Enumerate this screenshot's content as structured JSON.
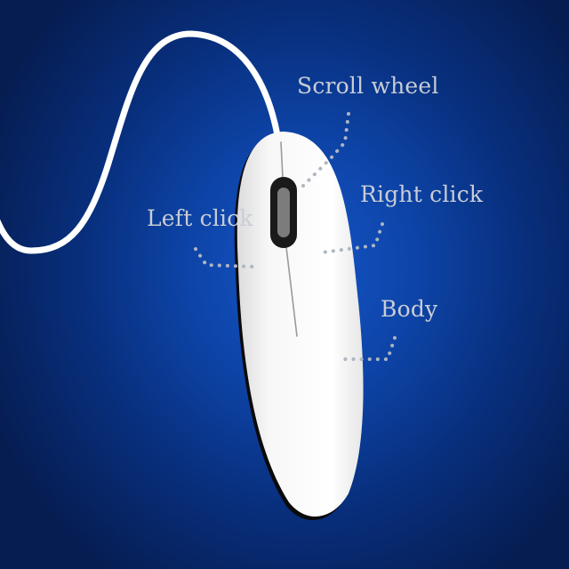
{
  "labels": {
    "scroll_wheel": "Scroll wheel",
    "left_click": "Left click",
    "right_click": "Right click",
    "body": "Body"
  },
  "colors": {
    "background": "#0d43a6",
    "mouse_shell": "#f4f4f4",
    "cable": "#ffffff",
    "label_text": "#c8cdd6"
  }
}
